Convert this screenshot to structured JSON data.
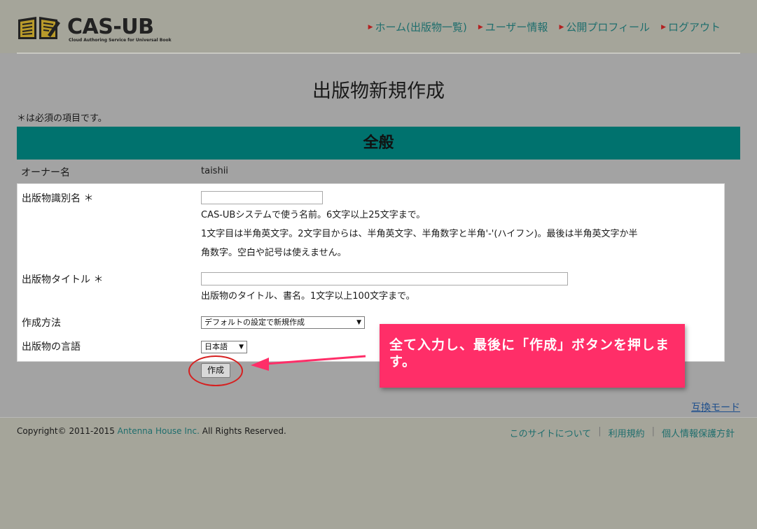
{
  "header": {
    "logo_name": "CAS-UB",
    "logo_tagline": "Cloud Authoring Service for Universal Book",
    "nav": [
      {
        "label": "ホーム(出版物一覧)"
      },
      {
        "label": "ユーザー情報"
      },
      {
        "label": "公開プロフィール"
      },
      {
        "label": "ログアウト"
      }
    ]
  },
  "page": {
    "title": "出版物新規作成",
    "required_note": "＊は必須の項目です。",
    "section_title": "全般"
  },
  "form": {
    "owner_label": "オーナー名",
    "owner_value": "taishii",
    "identifier_label": "出版物識別名 ＊",
    "identifier_value": "",
    "identifier_help_1": "CAS-UBシステムで使う名前。6文字以上25文字まで。",
    "identifier_help_2": "1文字目は半角英文字。2文字目からは、半角英文字、半角数字と半角'-'(ハイフン)。最後は半角英文字か半",
    "identifier_help_3": "角数字。空白や記号は使えません。",
    "title_label": "出版物タイトル ＊",
    "title_value": "",
    "title_help": "出版物のタイトル、書名。1文字以上100文字まで。",
    "method_label": "作成方法",
    "method_selected": "デフォルトの設定で新規作成",
    "language_label": "出版物の言語",
    "language_selected": "日本語",
    "create_button": "作成"
  },
  "annotation": {
    "callout_text": "全て入力し、最後に「作成」ボタンを押します。",
    "callout_color": "#ff2e68",
    "circle_color": "#d62020"
  },
  "links": {
    "compat_mode": "互換モード"
  },
  "footer": {
    "copyright_prefix": "Copyright© 2011-2015 ",
    "company": "Antenna House Inc.",
    "copyright_suffix": " All Rights Reserved.",
    "links": [
      {
        "label": "このサイトについて"
      },
      {
        "label": "利用規約"
      },
      {
        "label": "個人情報保護方針"
      }
    ]
  },
  "colors": {
    "accent_teal": "#00726e",
    "link_teal": "#1f6e6d",
    "overlay_gray": "#a3a3a3"
  }
}
